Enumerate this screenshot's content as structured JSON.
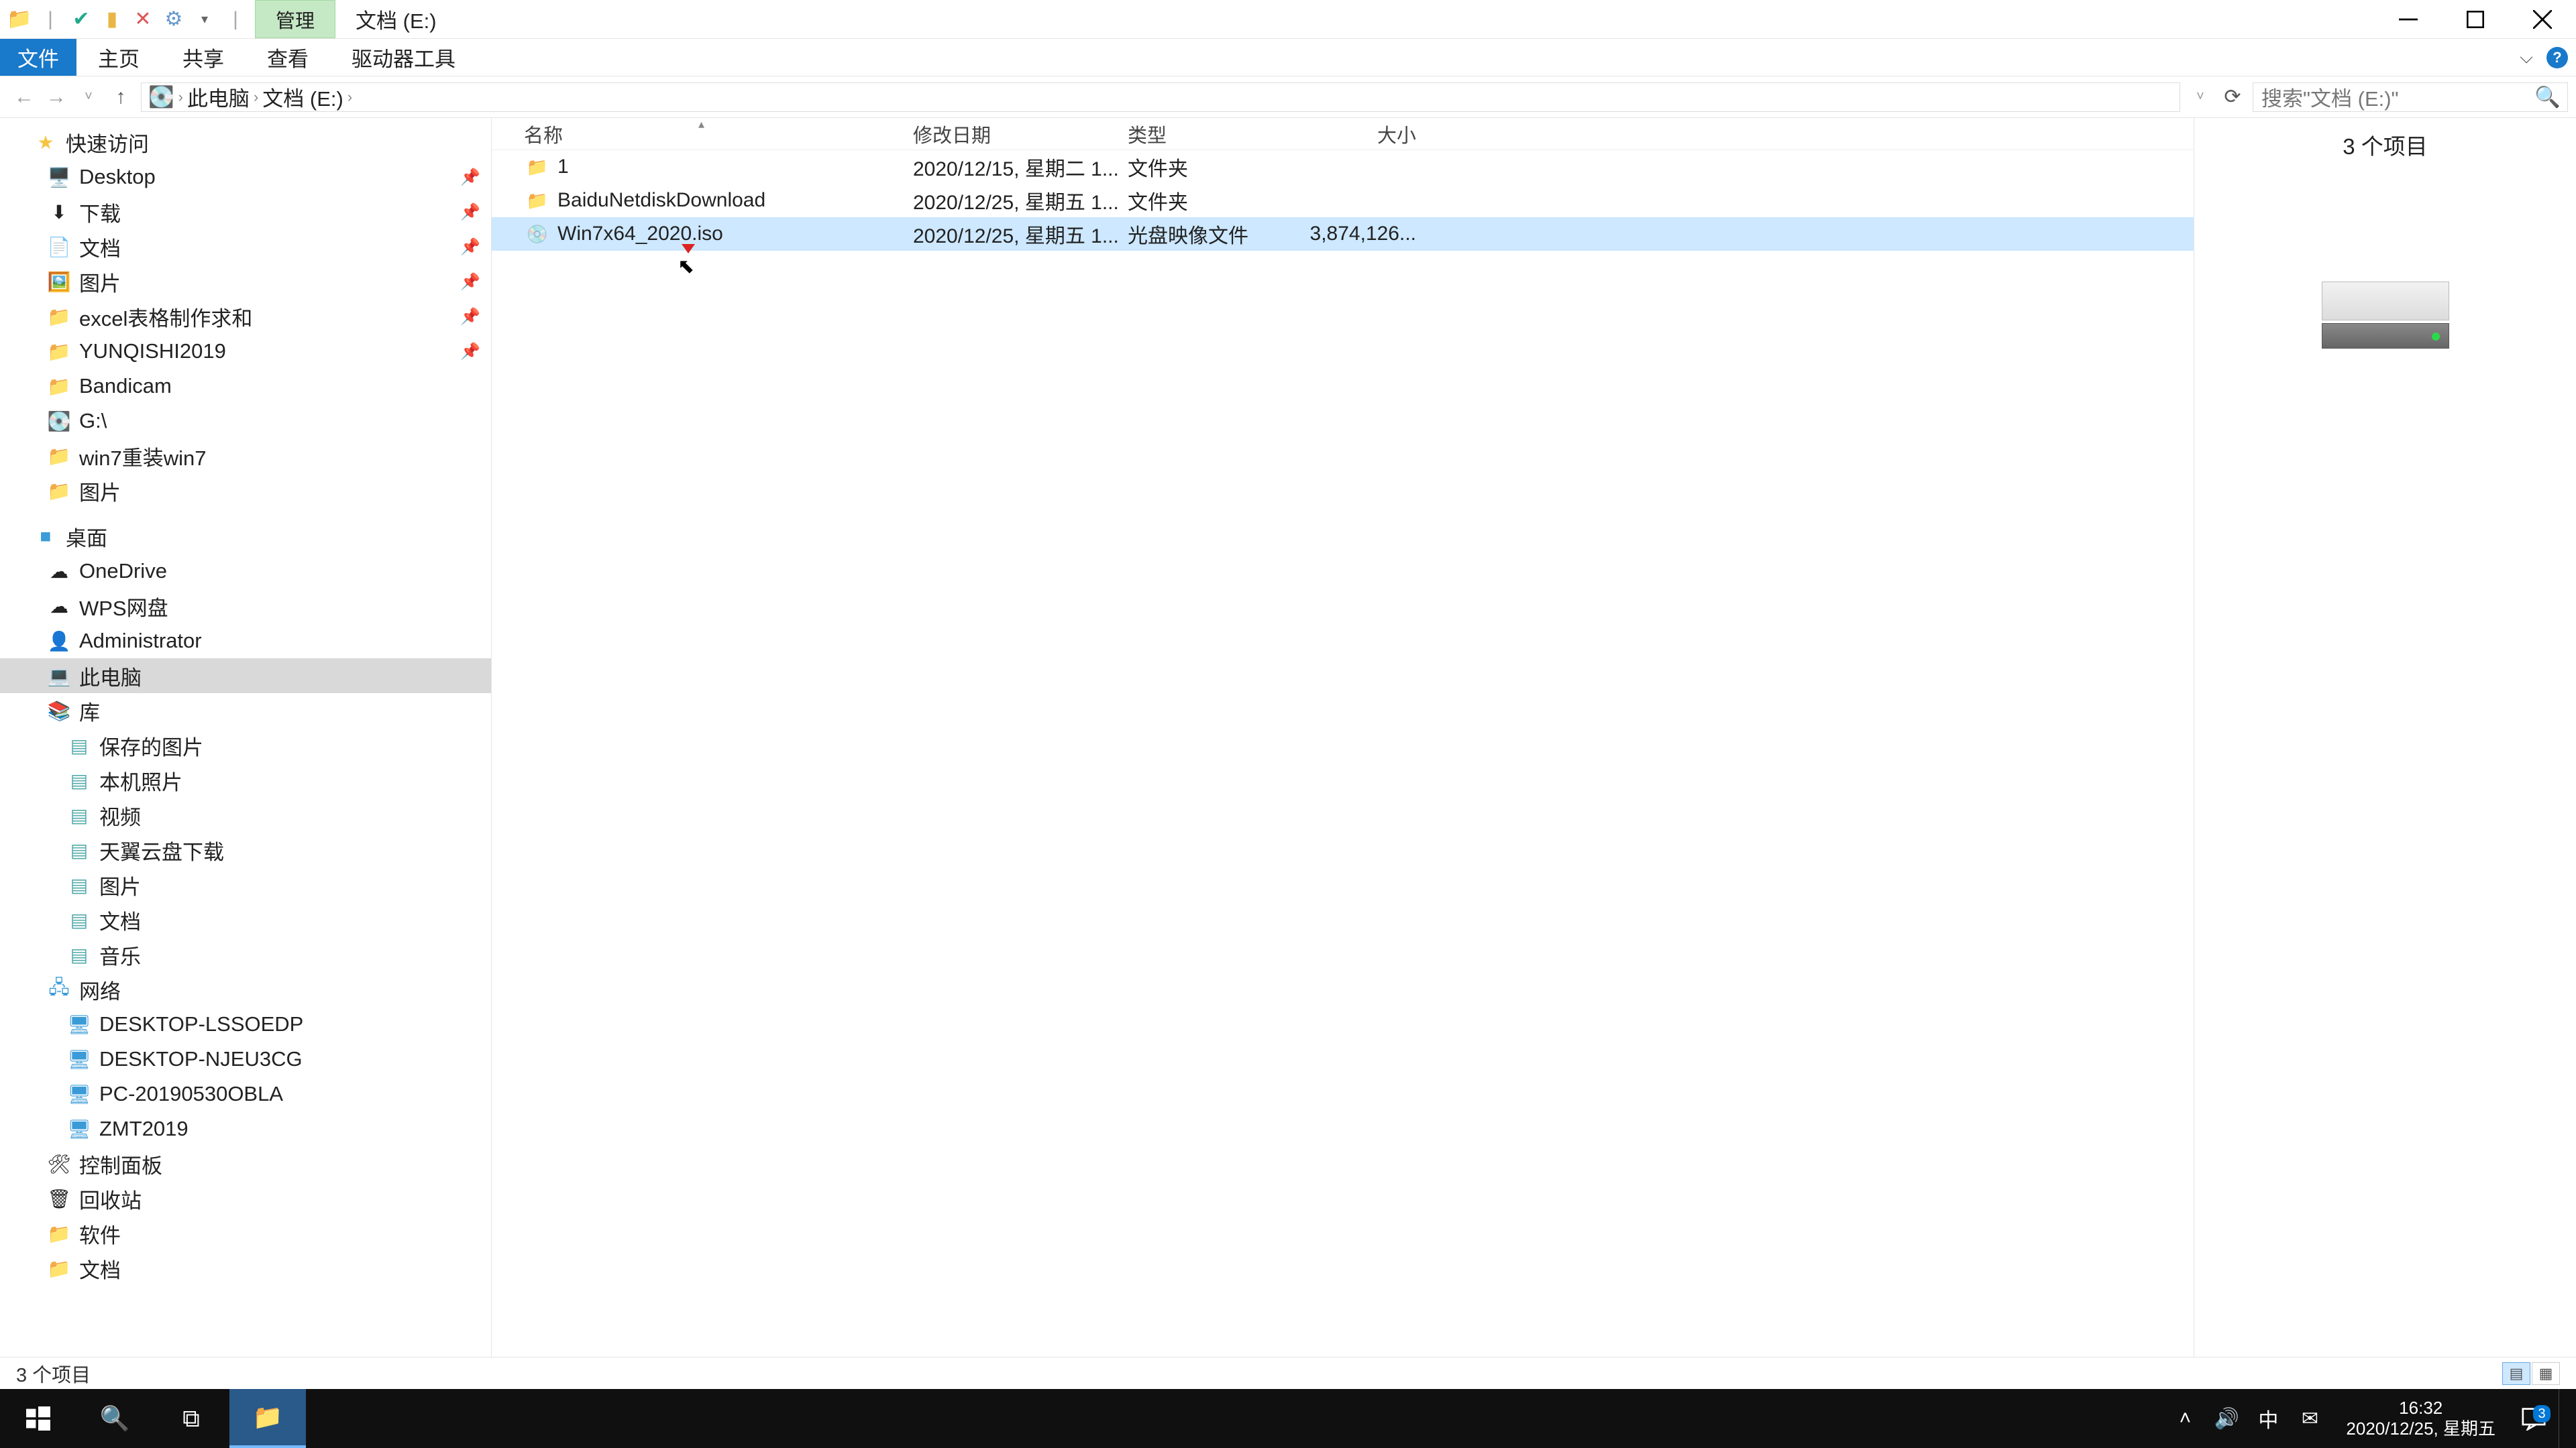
{
  "window": {
    "contextual_tab": "管理",
    "title": "文档 (E:)"
  },
  "ribbon": {
    "file": "文件",
    "home": "主页",
    "share": "共享",
    "view": "查看",
    "drive_tools": "驱动器工具"
  },
  "address": {
    "crumb1": "此电脑",
    "crumb2": "文档 (E:)"
  },
  "search": {
    "placeholder": "搜索\"文档 (E:)\""
  },
  "tree": {
    "quick": "快速访问",
    "q_items": [
      {
        "label": "Desktop",
        "icon": "🖥️"
      },
      {
        "label": "下载",
        "icon": "⬇"
      },
      {
        "label": "文档",
        "icon": "📄"
      },
      {
        "label": "图片",
        "icon": "🖼️"
      },
      {
        "label": "excel表格制作求和",
        "icon": "📁"
      },
      {
        "label": "YUNQISHI2019",
        "icon": "📁"
      },
      {
        "label": "Bandicam",
        "icon": "📁"
      },
      {
        "label": "G:\\",
        "icon": "💽"
      },
      {
        "label": "win7重装win7",
        "icon": "📁"
      },
      {
        "label": "图片",
        "icon": "📁"
      }
    ],
    "desktop": "桌面",
    "d_items": [
      {
        "label": "OneDrive",
        "icon": "☁"
      },
      {
        "label": "WPS网盘",
        "icon": "☁"
      },
      {
        "label": "Administrator",
        "icon": "👤"
      },
      {
        "label": "此电脑",
        "icon": "💻",
        "selected": true
      },
      {
        "label": "库",
        "icon": "📚"
      }
    ],
    "lib_items": [
      {
        "label": "保存的图片"
      },
      {
        "label": "本机照片"
      },
      {
        "label": "视频"
      },
      {
        "label": "天翼云盘下载"
      },
      {
        "label": "图片"
      },
      {
        "label": "文档"
      },
      {
        "label": "音乐"
      }
    ],
    "network": "网络",
    "n_items": [
      {
        "label": "DESKTOP-LSSOEDP"
      },
      {
        "label": "DESKTOP-NJEU3CG"
      },
      {
        "label": "PC-20190530OBLA"
      },
      {
        "label": "ZMT2019"
      }
    ],
    "cp": "控制面板",
    "recycle": "回收站",
    "software": "软件",
    "doc2": "文档"
  },
  "columns": {
    "name": "名称",
    "date": "修改日期",
    "type": "类型",
    "size": "大小"
  },
  "rows": [
    {
      "icon": "📁",
      "name": "1",
      "date": "2020/12/15, 星期二 1...",
      "type": "文件夹",
      "size": ""
    },
    {
      "icon": "📁",
      "name": "BaiduNetdiskDownload",
      "date": "2020/12/25, 星期五 1...",
      "type": "文件夹",
      "size": ""
    },
    {
      "icon": "💿",
      "name": "Win7x64_2020.iso",
      "date": "2020/12/25, 星期五 1...",
      "type": "光盘映像文件",
      "size": "3,874,126...",
      "selected": true
    }
  ],
  "preview": {
    "count": "3 个项目"
  },
  "status": {
    "count": "3 个项目"
  },
  "taskbar": {
    "time": "16:32",
    "date": "2020/12/25, 星期五",
    "ime": "中",
    "badge": "3"
  }
}
